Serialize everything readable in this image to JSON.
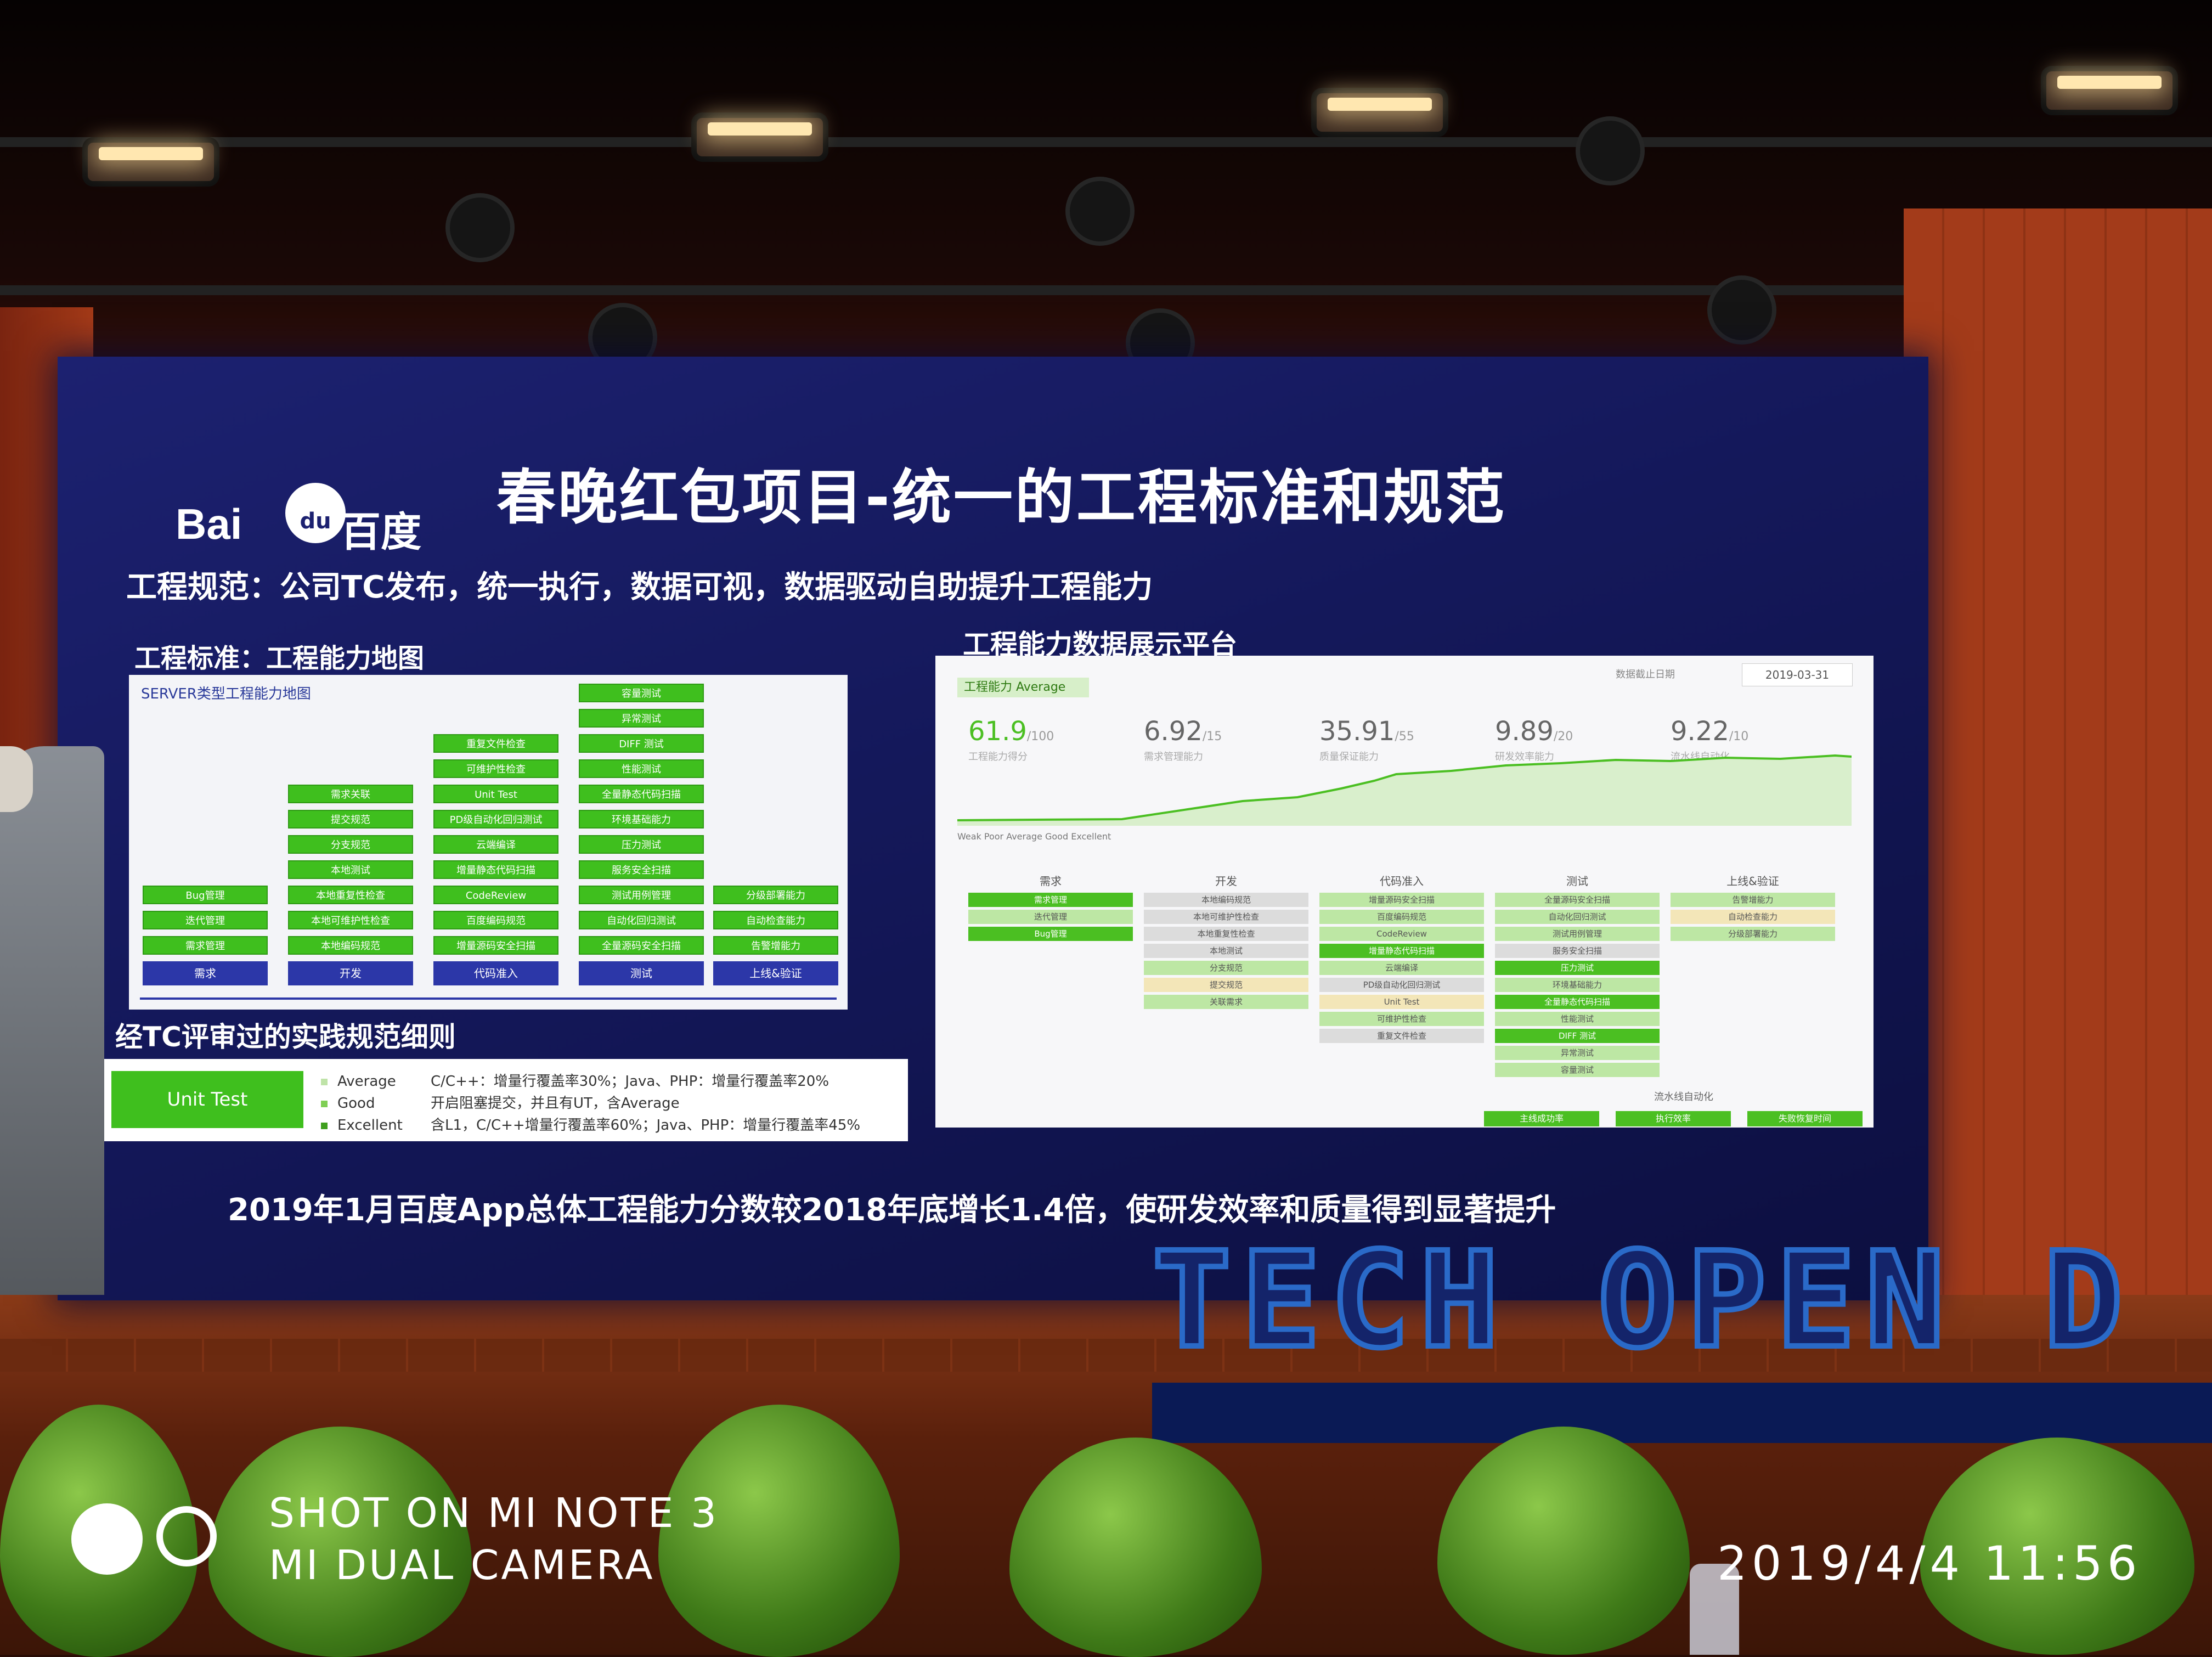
{
  "slide": {
    "logo_latin": "Bai",
    "logo_paw": "du",
    "logo_cn": "百度",
    "title": "春晚红包项目-统一的工程标准和规范",
    "subtitle": "工程规范：公司TC发布，统一执行，数据可视，数据驱动自助提升工程能力",
    "standards_heading": "工程标准：工程能力地图",
    "platform_heading": "工程能力数据展示平台",
    "rules_heading": "经TC评审过的实践规范细则",
    "bottom_line": "2019年1月百度App总体工程能力分数较2018年底增长1.4倍，使研发效率和质量得到显著提升"
  },
  "capability_map": {
    "title": "SERVER类型工程能力地图",
    "columns": [
      {
        "stage": "需求",
        "items": [
          "Bug管理",
          "迭代管理",
          "需求管理"
        ]
      },
      {
        "stage": "开发",
        "items": [
          "需求关联",
          "提交规范",
          "分支规范",
          "本地测试",
          "本地重复性检查",
          "本地可维护性检查",
          "本地编码规范"
        ]
      },
      {
        "stage": "代码准入",
        "items": [
          "重复文件检查",
          "可维护性检查",
          "Unit Test",
          "PD级自动化回归测试",
          "云端编译",
          "增量静态代码扫描",
          "CodeReview",
          "百度编码规范",
          "增量源码安全扫描"
        ]
      },
      {
        "stage": "测试",
        "items": [
          "容量测试",
          "异常测试",
          "DIFF 测试",
          "性能测试",
          "全量静态代码扫描",
          "环境基础能力",
          "压力测试",
          "服务安全扫描",
          "测试用例管理",
          "自动化回归测试",
          "全量源码安全扫描"
        ]
      },
      {
        "stage": "上线&验证",
        "items": [
          "分级部署能力",
          "自动检查能力",
          "告警增能力"
        ]
      }
    ]
  },
  "rules": {
    "badge": "Unit Test",
    "colors": {
      "average": "#bfe3a8",
      "good": "#7fcf55",
      "excellent": "#3f9f1e"
    },
    "levels": [
      {
        "name": "Average",
        "text": "C/C++：增量行覆盖率30%；Java、PHP：增量行覆盖率20%"
      },
      {
        "name": "Good",
        "text": "开启阻塞提交，并且有UT，含Average"
      },
      {
        "name": "Excellent",
        "text": "含L1，C/C++增量行覆盖率60%；Java、PHP：增量行覆盖率45%"
      }
    ]
  },
  "platform": {
    "tab": "工程能力  Average",
    "date_label": "数据截止日期",
    "date": "2019-03-31",
    "metrics": [
      {
        "value": "61.9",
        "scale": "/100",
        "label": "工程能力得分"
      },
      {
        "value": "6.92",
        "scale": "/15",
        "label": "需求管理能力"
      },
      {
        "value": "35.91",
        "scale": "/55",
        "label": "质量保证能力"
      },
      {
        "value": "9.89",
        "scale": "/20",
        "label": "研发效率能力"
      },
      {
        "value": "9.22",
        "scale": "/10",
        "label": "流水线自动化"
      }
    ],
    "legend": "Weak   Poor   Average   Good   Excellent",
    "columns": [
      {
        "head": "需求",
        "cells": [
          [
            "需求管理",
            "g"
          ],
          [
            "迭代管理",
            "l"
          ],
          [
            "Bug管理",
            "g"
          ]
        ]
      },
      {
        "head": "开发",
        "cells": [
          [
            "本地编码规范",
            "x"
          ],
          [
            "本地可维护性检查",
            "x"
          ],
          [
            "本地重复性检查",
            "x"
          ],
          [
            "本地测试",
            "x"
          ],
          [
            "分支规范",
            "l"
          ],
          [
            "提交规范",
            "y"
          ],
          [
            "关联需求",
            "l"
          ]
        ]
      },
      {
        "head": "代码准入",
        "cells": [
          [
            "增量源码安全扫描",
            "l"
          ],
          [
            "百度编码规范",
            "l"
          ],
          [
            "CodeReview",
            "l"
          ],
          [
            "增量静态代码扫描",
            "g"
          ],
          [
            "云端编译",
            "l"
          ],
          [
            "PD级自动化回归测试",
            "x"
          ],
          [
            "Unit Test",
            "y"
          ],
          [
            "可维护性检查",
            "l"
          ],
          [
            "重复文件检查",
            "x"
          ]
        ]
      },
      {
        "head": "测试",
        "cells": [
          [
            "全量源码安全扫描",
            "l"
          ],
          [
            "自动化回归测试",
            "l"
          ],
          [
            "测试用例管理",
            "l"
          ],
          [
            "服务安全扫描",
            "x"
          ],
          [
            "压力测试",
            "g"
          ],
          [
            "环境基础能力",
            "l"
          ],
          [
            "全量静态代码扫描",
            "g"
          ],
          [
            "性能测试",
            "l"
          ],
          [
            "DIFF 测试",
            "g"
          ],
          [
            "异常测试",
            "l"
          ],
          [
            "容量测试",
            "l"
          ]
        ]
      },
      {
        "head": "上线&验证",
        "cells": [
          [
            "告警增能力",
            "l"
          ],
          [
            "自动检查能力",
            "y"
          ],
          [
            "分级部署能力",
            "l"
          ]
        ]
      }
    ],
    "flow_label": "流水线自动化",
    "flow_buttons": [
      "主线成功率",
      "执行效率",
      "失败恢复时间"
    ]
  },
  "branding": {
    "event": "TECH OPEN D"
  },
  "watermark": {
    "line1": "SHOT ON MI NOTE 3",
    "line2": "MI DUAL CAMERA",
    "timestamp": "2019/4/4  11:56"
  }
}
